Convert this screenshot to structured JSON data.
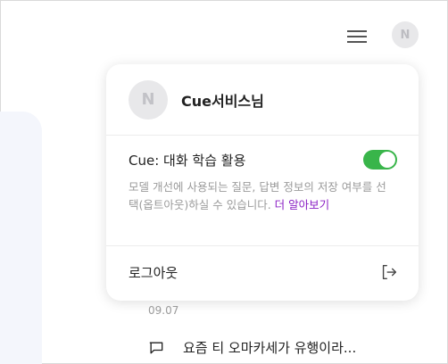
{
  "header": {
    "avatar_initial": "N"
  },
  "profile_popup": {
    "avatar_initial": "N",
    "user_name": "Cue서비스님",
    "learning": {
      "title": "Cue: 대화 학습 활용",
      "toggle_on": true,
      "description": "모델 개선에 사용되는 질문, 답변 정보의 저장 여부를 선택(옵트아웃)하실 수 있습니다.",
      "more_link": "더 알아보기"
    },
    "logout_label": "로그아웃"
  },
  "history": {
    "date": "09.07",
    "items": [
      {
        "title": "요즘 티 오마카세가 유행이라..."
      }
    ]
  },
  "colors": {
    "toggle_on": "#39b54a",
    "link": "#8a1ec4",
    "panel_bg": "#f4f6fc"
  }
}
